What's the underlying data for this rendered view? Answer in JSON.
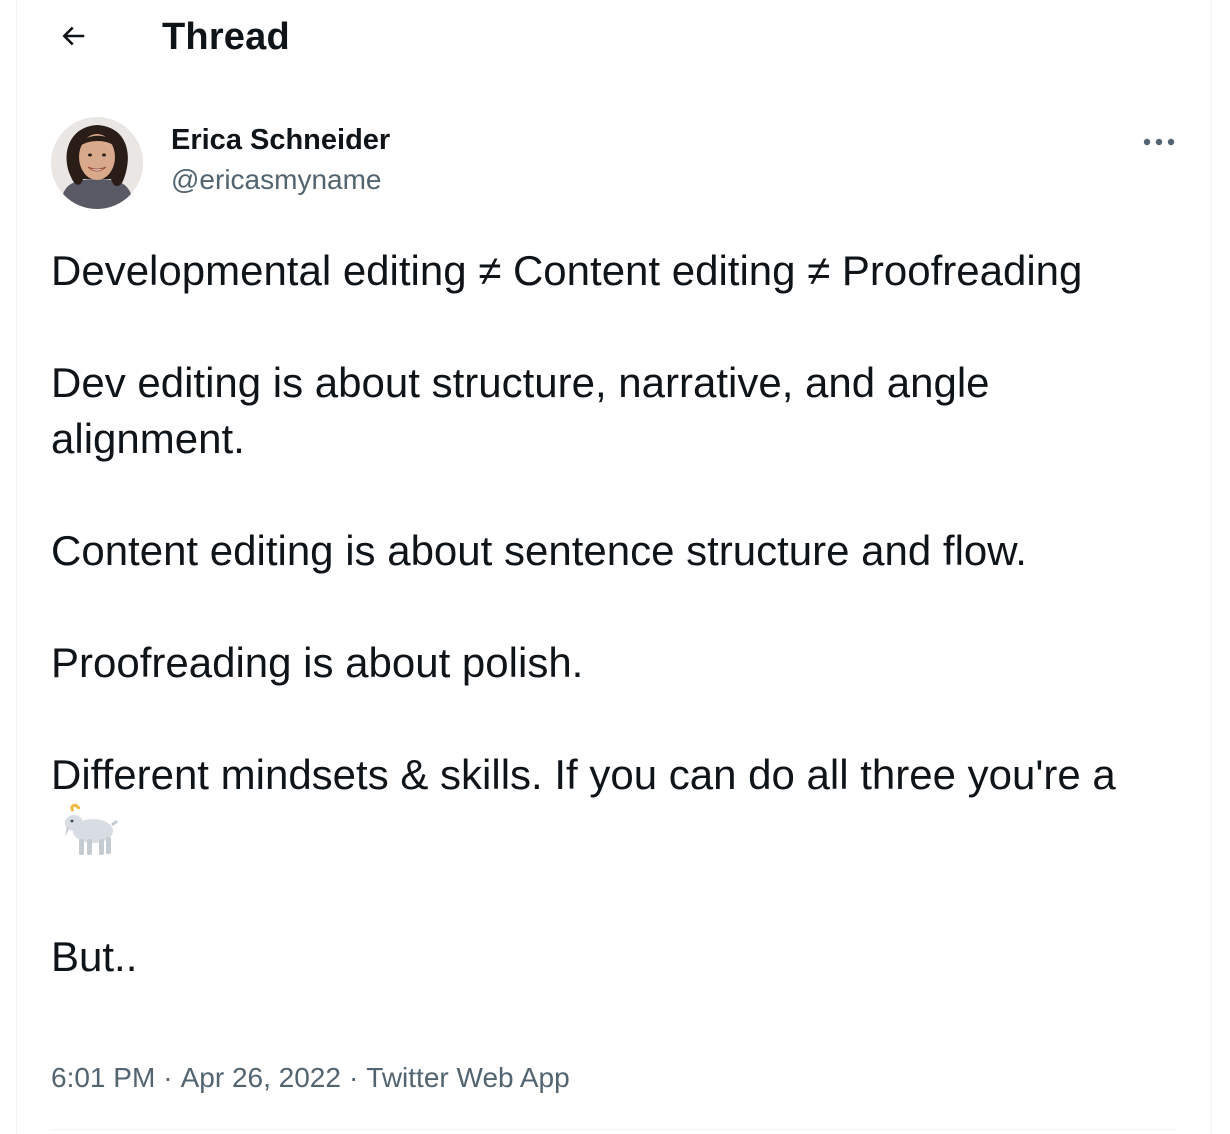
{
  "header": {
    "back_icon": "arrow-left-icon",
    "title": "Thread"
  },
  "author": {
    "name": "Erica Schneider",
    "handle": "@ericasmyname",
    "avatar_icon": "avatar-photo"
  },
  "more_icon": "more-horizontal-icon",
  "tweet": {
    "paragraphs": [
      "Developmental editing ≠ Content editing ≠ Proofreading",
      "Dev editing is about structure, narrative, and angle alignment.",
      "Content editing is about sentence structure and flow.",
      "Proofreading is about polish.",
      "Different mindsets & skills. If you can do all three you're a",
      "But.."
    ],
    "emoji": "goat-emoji"
  },
  "meta": {
    "time": "6:01 PM",
    "date": "Apr 26, 2022",
    "source": "Twitter Web App",
    "separator": "·"
  },
  "colors": {
    "text_primary": "#0f1419",
    "text_secondary": "#536471",
    "divider": "#eff3f4"
  }
}
